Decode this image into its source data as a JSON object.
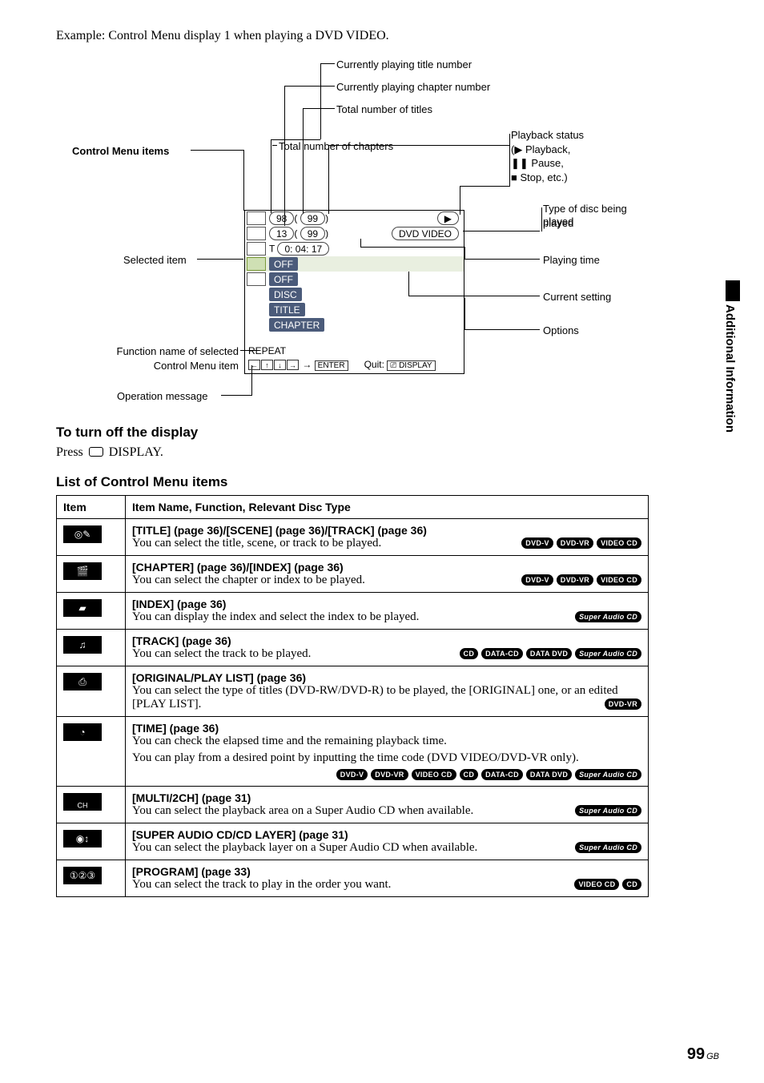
{
  "example_line": "Example: Control Menu display 1 when playing a DVD VIDEO.",
  "section_side_tab": "Additional Information",
  "page_number": "99",
  "page_region": "GB",
  "diagram": {
    "labels": {
      "control_menu_items": "Control Menu items",
      "currently_playing_title": "Currently playing title number",
      "currently_playing_chapter": "Currently playing chapter number",
      "total_titles": "Total number of titles",
      "total_chapters": "Total number of chapters",
      "playback_status_head": "Playback status",
      "playback_status_play": "(▶ Playback,",
      "playback_status_pause": "❚❚ Pause,",
      "playback_status_stop": "■ Stop, etc.)",
      "type_of_disc": "Type of disc being played",
      "playing_time": "Playing time",
      "current_setting": "Current setting",
      "options": "Options",
      "selected_item": "Selected item",
      "function_name_l1": "Function name of selected",
      "function_name_l2": "Control Menu item",
      "operation_message": "Operation message"
    },
    "osd": {
      "title_current": "98",
      "title_total": "99",
      "chapter_current": "13",
      "chapter_total": "99",
      "time_prefix": "T",
      "time_value": "0: 04: 17",
      "disc_type": "DVD VIDEO",
      "rows": [
        "OFF",
        "OFF",
        "DISC",
        "TITLE",
        "CHAPTER"
      ],
      "function_name": "REPEAT",
      "enter": "ENTER",
      "quit_label": "Quit:",
      "display": "DISPLAY",
      "play_glyph": "▶"
    }
  },
  "headings": {
    "turn_off": "To turn off the display",
    "press_prefix": "Press ",
    "press_suffix": " DISPLAY.",
    "list_heading": "List of Control Menu items"
  },
  "table": {
    "col_item": "Item",
    "col_desc": "Item Name, Function, Relevant Disc Type",
    "rows": [
      {
        "iconGlyph": "◎✎",
        "title": "[TITLE] (page 36)/[SCENE] (page 36)/[TRACK] (page 36)",
        "desc": "You can select the title, scene, or track to be played.",
        "badges": [
          "DVD-V",
          "DVD-VR",
          "VIDEO CD"
        ]
      },
      {
        "iconGlyph": "🎬",
        "title": "[CHAPTER] (page 36)/[INDEX] (page 36)",
        "desc": "You can select the chapter or index to be played.",
        "badges": [
          "DVD-V",
          "DVD-VR",
          "VIDEO CD"
        ]
      },
      {
        "iconGlyph": "▰",
        "title": "[INDEX] (page 36)",
        "desc": "You can display the index and select the index to be played.",
        "badges": [
          "Super Audio CD"
        ]
      },
      {
        "iconGlyph": "♫",
        "title": "[TRACK] (page 36)",
        "desc": "You can select the track to be played.",
        "badges": [
          "CD",
          "DATA-CD",
          "DATA DVD",
          "Super Audio CD"
        ]
      },
      {
        "iconGlyph": "⎙",
        "title": "[ORIGINAL/PLAY LIST] (page 36)",
        "desc": "You can select the type of titles (DVD-RW/DVD-R) to be played, the [ORIGINAL] one, or an edited [PLAY LIST].",
        "badges": [
          "DVD-VR"
        ]
      },
      {
        "iconGlyph": "◔",
        "title": "[TIME] (page 36)",
        "desc": "You can check the elapsed time and the remaining playback time.",
        "sub_desc": "You can play from a desired point by inputting the time code (DVD VIDEO/DVD-VR only).",
        "badges_row": [
          "DVD-V",
          "DVD-VR",
          "VIDEO CD",
          "CD",
          "DATA-CD",
          "DATA DVD",
          "Super Audio CD"
        ]
      },
      {
        "iconGlyph": "",
        "iconSuffix": "CH",
        "title": "[MULTI/2CH] (page 31)",
        "desc": "You can select the playback area on a Super Audio CD when available.",
        "badges": [
          "Super Audio CD"
        ]
      },
      {
        "iconGlyph": "◉↕",
        "title": "[SUPER AUDIO CD/CD LAYER] (page 31)",
        "desc": "You can select the playback layer on a Super Audio CD when available.",
        "badges": [
          "Super Audio CD"
        ]
      },
      {
        "iconGlyph": "①②③",
        "title": "[PROGRAM] (page 33)",
        "desc": "You can select the track to play in the order you want.",
        "badges": [
          "VIDEO CD",
          "CD"
        ]
      }
    ]
  }
}
